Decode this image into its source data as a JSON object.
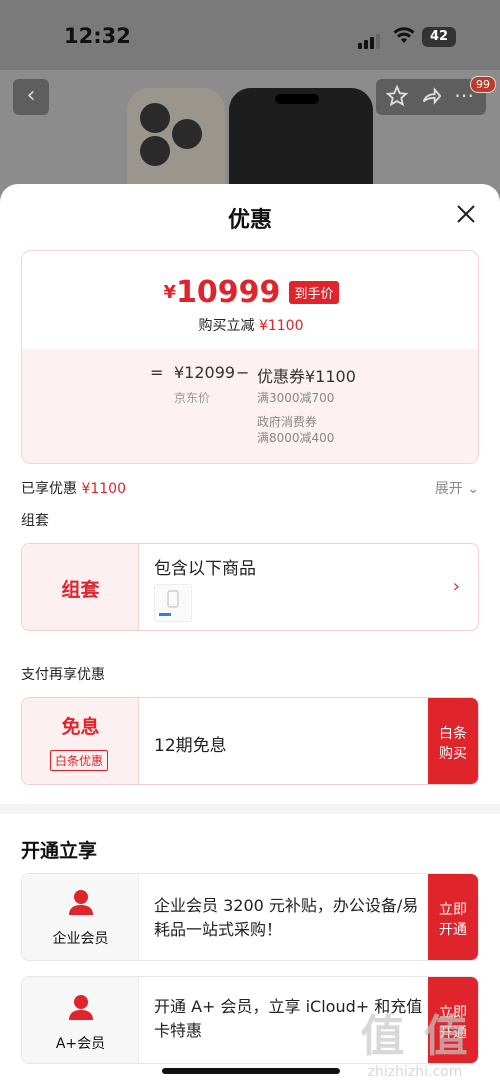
{
  "status": {
    "time": "12:32",
    "battery": "42"
  },
  "header": {
    "badge": "99"
  },
  "sheet": {
    "title": "优惠",
    "price": {
      "currency": "¥",
      "amount": "10999",
      "tag": "到手价",
      "sub_label": "购买立减",
      "sub_value": "¥1100",
      "eq": "=",
      "original": "¥12099",
      "minus": "−",
      "coupon": "优惠券¥1100",
      "original_label": "京东价",
      "coupon_detail_1": "满3000减700",
      "coupon_detail_2": "政府消费券",
      "coupon_detail_3": "满8000减400"
    },
    "enjoyed": {
      "label": "已享优惠",
      "value": "¥1100",
      "expand": "展开"
    },
    "bundle": {
      "section": "组套",
      "title": "组套",
      "text": "包含以下商品",
      "chevron": "›"
    },
    "pay": {
      "section": "支付再享优惠",
      "title": "免息",
      "pill": "白条优惠",
      "text": "12期免息",
      "btn_line1": "白条",
      "btn_line2": "购买"
    },
    "open": {
      "title": "开通立享",
      "members": [
        {
          "name": "企业会员",
          "desc": "企业会员 3200 元补贴，办公设备/易耗品一站式采购！",
          "btn_line1": "立即",
          "btn_line2": "开通"
        },
        {
          "name": "A+会员",
          "desc": "开通 A+ 会员，立享 iCloud+ 和充值卡特惠",
          "btn_line1": "立即",
          "btn_line2": "开通"
        }
      ]
    }
  },
  "watermark": {
    "big": "值 值",
    "small": "zhizhizhi.com"
  },
  "colors": {
    "accent": "#e0242b",
    "card_bg": "#fdf0f1"
  }
}
